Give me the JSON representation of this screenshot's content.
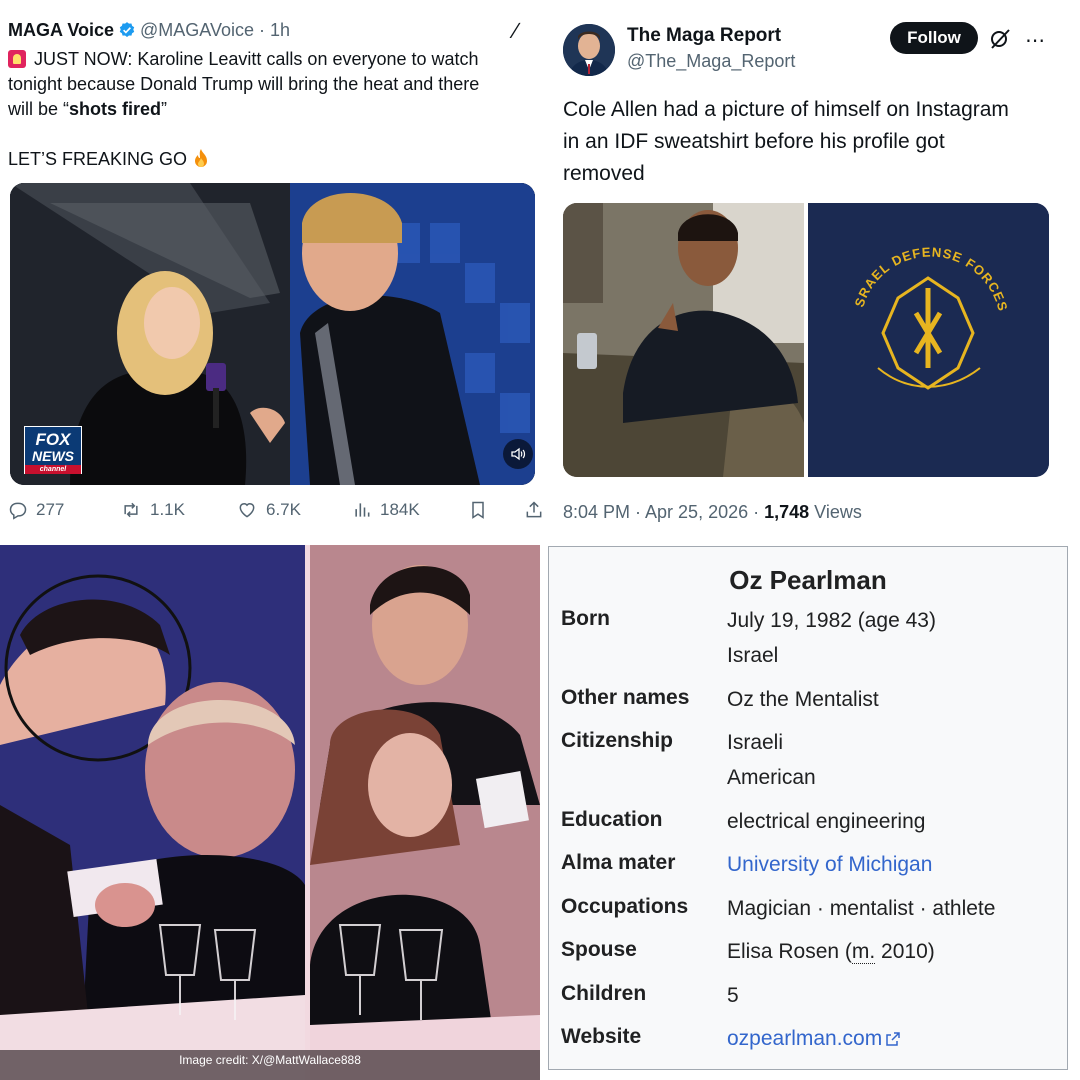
{
  "tweet1": {
    "name": "MAGA Voice",
    "handle_time": "@MAGAVoice · 1h",
    "text_line1": "JUST NOW: Karoline Leavitt calls on everyone to watch",
    "text_line2": "tonight because Donald Trump will bring the heat and there",
    "text_line3_pre": "will be “",
    "text_line3_bold": "shots fired",
    "text_line3_post": "”",
    "text_line4": "LET’S FREAKING GO",
    "media_logo_line1": "FOX",
    "media_logo_line2": "NEWS",
    "media_logo_line3": "channel",
    "actions": {
      "replies": "277",
      "reposts": "1.1K",
      "likes": "6.7K",
      "views": "184K"
    }
  },
  "tweet2": {
    "name": "The Maga Report",
    "handle": "@The_Maga_Report",
    "follow_label": "Follow",
    "text_line1": "Cole Allen had a picture of himself on Instagram",
    "text_line2": "in an IDF sweatshirt before his profile got",
    "text_line3": "removed",
    "sweatshirt_text": "ISRAEL DEFENSE FORCES",
    "time": "8:04 PM · Apr 25, 2026 · ",
    "views_count": "1,748",
    "views_label": " Views"
  },
  "photo": {
    "credit": "Image credit: X/@MattWallace888"
  },
  "infobox": {
    "title": "Oz Pearlman",
    "rows": [
      {
        "label": "Born",
        "value1": "July 19, 1982 (age 43)",
        "value2": "Israel"
      },
      {
        "label": "Other names",
        "value1": "Oz the Mentalist"
      },
      {
        "label": "Citizenship",
        "value1": "Israeli",
        "value2": "American"
      },
      {
        "label": "Education",
        "value1": "electrical engineering"
      },
      {
        "label": "Alma mater",
        "value1": "University of Michigan"
      },
      {
        "label": "Occupations",
        "value1": "Magician · mentalist · athlete"
      },
      {
        "label": "Spouse",
        "value_pre": "Elisa Rosen (",
        "value_abbr": "m.",
        "value_post": " 2010)"
      },
      {
        "label": "Children",
        "value1": "5"
      },
      {
        "label": "Website",
        "value1": "ozpearlman.com"
      }
    ]
  },
  "colors": {
    "verified": "#1d9bf0",
    "link": "#3366cc",
    "muted": "#536471"
  }
}
